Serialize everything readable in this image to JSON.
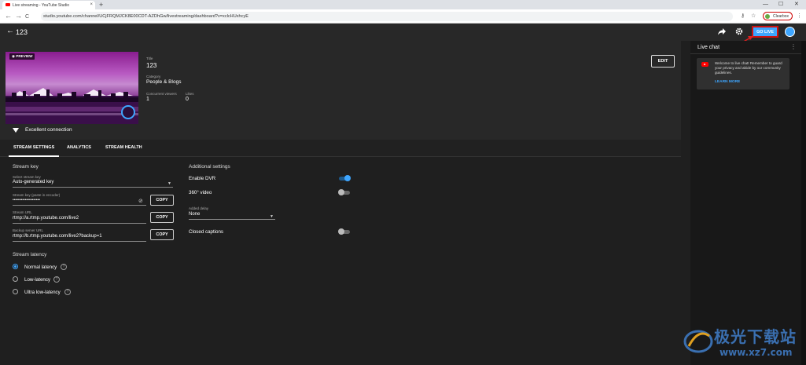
{
  "browser": {
    "tab_title": "Live streaming - YouTube Studio",
    "tab_close": "×",
    "new_tab": "+",
    "url": "studio.youtube.com/channel/UCjFRQMJCK8E00CDT-AZDhGw/livestreaming/dashboard?v=xclcHUxhcyE",
    "profile_name": "Clearbox",
    "back": "←",
    "forward": "→",
    "reload": "C",
    "minimize": "—",
    "maximize": "☐",
    "close": "✕"
  },
  "header": {
    "back_arrow": "←",
    "title": "123",
    "go_live_label": "GO LIVE"
  },
  "preview": {
    "label": "PREVIEW",
    "connection": "Excellent connection"
  },
  "info": {
    "title_label": "Title",
    "title_value": "123",
    "category_label": "Category",
    "category_value": "People & Blogs",
    "viewers_label": "Concurrent viewers",
    "viewers_value": "1",
    "likes_label": "Likes",
    "likes_value": "0",
    "edit_label": "EDIT"
  },
  "tabs": [
    {
      "label": "STREAM SETTINGS"
    },
    {
      "label": "ANALYTICS"
    },
    {
      "label": "STREAM HEALTH"
    }
  ],
  "stream_key": {
    "section": "Stream key",
    "select_label": "Select stream key",
    "select_value": "Auto-generated key",
    "key_label": "Stream key (paste in encoder)",
    "key_value": "••••••••••••••••••••",
    "url_label": "Stream URL",
    "url_value": "rtmp://a.rtmp.youtube.com/live2",
    "backup_label": "Backup server URL",
    "backup_value": "rtmp://b.rtmp.youtube.com/live2?backup=1",
    "copy_label": "COPY"
  },
  "latency": {
    "section": "Stream latency",
    "options": [
      {
        "label": "Normal latency",
        "selected": true
      },
      {
        "label": "Low-latency",
        "selected": false
      },
      {
        "label": "Ultra low-latency",
        "selected": false
      }
    ],
    "help": "?"
  },
  "additional": {
    "section": "Additional settings",
    "dvr_label": "Enable DVR",
    "dvr_on": true,
    "video360_label": "360° video",
    "video360_on": false,
    "delay_label": "Added delay",
    "delay_value": "None",
    "captions_label": "Closed captions",
    "captions_on": false
  },
  "chat": {
    "title": "Live chat",
    "menu": "⋮",
    "message": "Welcome to live chat! Remember to guard your privacy and abide by our community guidelines.",
    "learn_more": "LEARN MORE"
  },
  "watermark": {
    "text": "极光下载站",
    "url": "www.xz7.com"
  },
  "colors": {
    "accent": "#3ea6ff",
    "highlight": "#cc1111",
    "background": "#1f1f1f"
  }
}
